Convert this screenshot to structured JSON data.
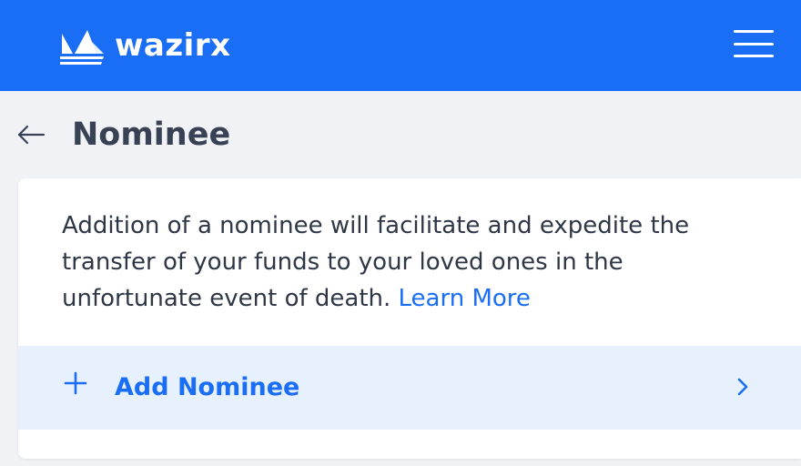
{
  "header": {
    "brand_name": "wazirx",
    "logo_icon": "wazirx-logo-icon",
    "menu_icon": "hamburger-menu-icon",
    "background_color": "#1a6ef5"
  },
  "page": {
    "back_icon": "arrow-left-icon",
    "title": "Nominee"
  },
  "card": {
    "description": "Addition of a nominee will facilitate and expedite the transfer of your funds to your loved ones in the unfortunate event of death.",
    "learn_more_label": "Learn More",
    "add_nominee": {
      "icon": "plus-icon",
      "label": "Add Nominee",
      "trailing_icon": "chevron-right-icon"
    }
  },
  "colors": {
    "accent": "#1a6ef5",
    "page_background": "#f0f2f6",
    "row_highlight": "#e7f0fd",
    "title_text": "#394255"
  }
}
